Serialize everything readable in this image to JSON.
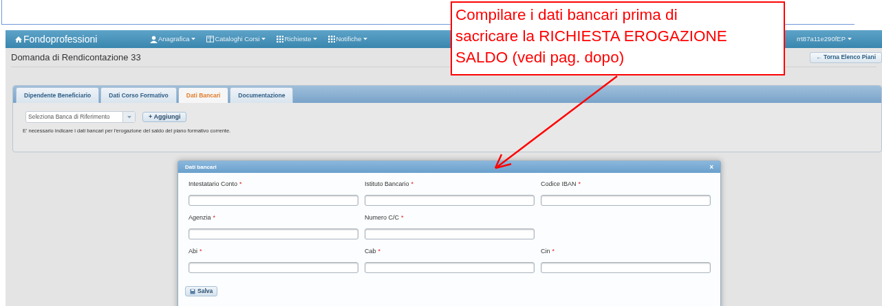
{
  "navbar": {
    "brand": "Fondoprofessioni",
    "menus": [
      {
        "label": "Anagrafica"
      },
      {
        "label": "Cataloghi Corsi"
      },
      {
        "label": "Richieste"
      },
      {
        "label": "Notifiche"
      }
    ],
    "user": "rrt87a11e290fEP"
  },
  "page": {
    "title": "Domanda di Rendicontazione 33",
    "back_button": "Torna Elenco Piani",
    "back_arrow": "←"
  },
  "tabs": [
    {
      "label": "Dipendente Beneficiario",
      "selected": false
    },
    {
      "label": "Dati Corso Formativo",
      "selected": false
    },
    {
      "label": "Dati Bancari",
      "selected": true
    },
    {
      "label": "Documentazione",
      "selected": false
    }
  ],
  "bank_select": {
    "value": "Seleziona Banca di Riferimento"
  },
  "add_button": "Aggiungi",
  "add_plus": "+",
  "notice": "E' necessario indicare i dati bancari per l'erogazione del saldo del piano formativo corrente.",
  "dialog": {
    "title": "Dati bancari",
    "close": "×",
    "rows": [
      [
        {
          "label": "Intestatario Conto",
          "required": true
        },
        {
          "label": "Istituto Bancario",
          "required": true
        },
        {
          "label": "Codice IBAN",
          "required": true
        }
      ],
      [
        {
          "label": "Agenzia",
          "required": true
        },
        {
          "label": "Numero C/C",
          "required": true
        }
      ],
      [
        {
          "label": "Abi",
          "required": true
        },
        {
          "label": "Cab",
          "required": true
        },
        {
          "label": "Cin",
          "required": true
        }
      ]
    ],
    "required_mark": "*",
    "save_button": "Salva"
  },
  "callout": {
    "text": "Compilare i dati bancari prima di\nsacricare la RICHIESTA EROGAZIONE\nSALDO (vedi pag. dopo)"
  }
}
